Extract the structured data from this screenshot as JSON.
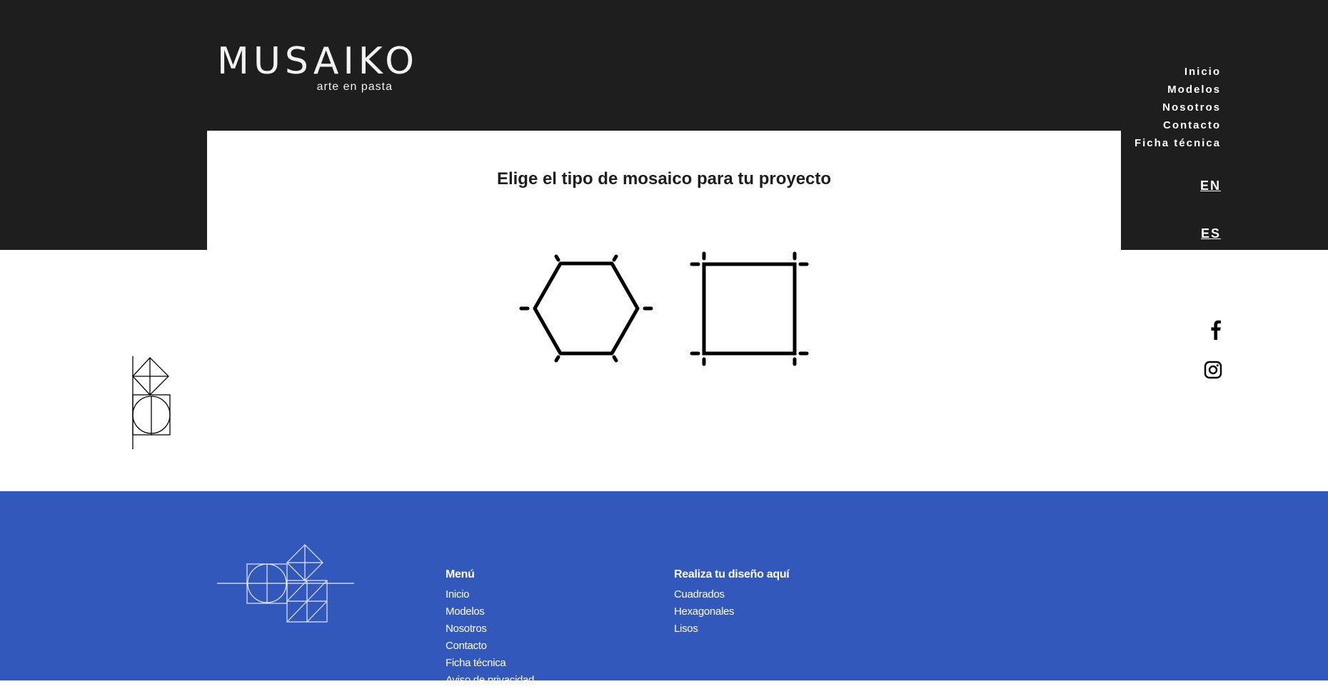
{
  "brand": {
    "name": "MUSAIKO",
    "tagline": "arte en pasta"
  },
  "nav": {
    "items": [
      {
        "label": "Inicio"
      },
      {
        "label": "Modelos"
      },
      {
        "label": "Nosotros"
      },
      {
        "label": "Contacto"
      },
      {
        "label": "Ficha técnica"
      }
    ],
    "languages": {
      "en": "EN",
      "es": "ES"
    }
  },
  "main": {
    "headline": "Elige el tipo de mosaico para tu proyecto",
    "tiles": [
      {
        "shape": "hexagon-icon"
      },
      {
        "shape": "square-icon"
      }
    ]
  },
  "social": {
    "icons": [
      "facebook-icon",
      "instagram-icon"
    ]
  },
  "footer": {
    "menu": {
      "heading": "Menú",
      "links": [
        "Inicio",
        "Modelos",
        "Nosotros",
        "Contacto",
        "Ficha técnica",
        "Aviso de privacidad"
      ]
    },
    "design": {
      "heading": "Realiza tu diseño aquí",
      "links": [
        "Cuadrados",
        "Hexagonales",
        "Lisos"
      ]
    }
  },
  "colors": {
    "header_bg": "#1e1e1e",
    "footer_bg": "#3358bc",
    "text_dark": "#1e1e1e",
    "text_light": "#ffffff"
  }
}
